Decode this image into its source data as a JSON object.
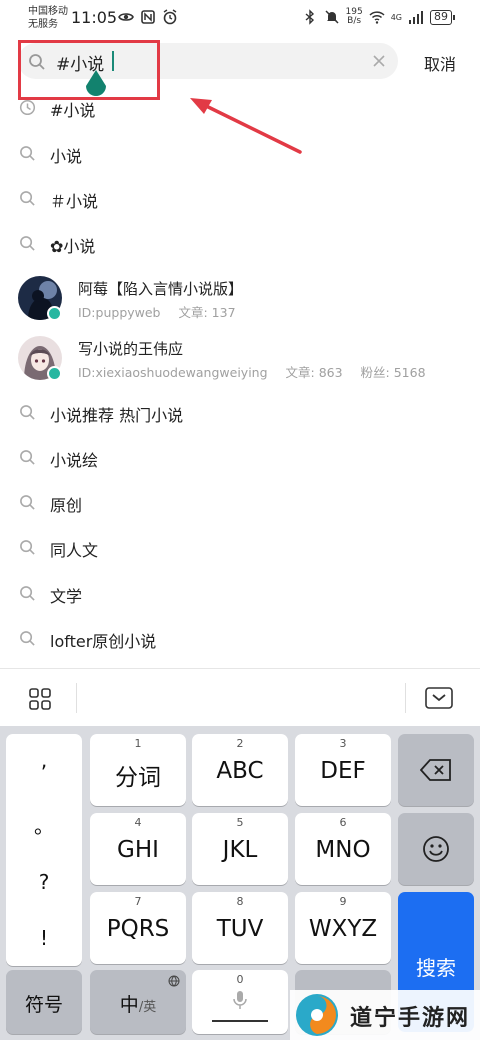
{
  "status_bar": {
    "carrier_line1": "中国移动",
    "carrier_line2": "无服务",
    "time": "11:05",
    "speed_top": "195",
    "speed_bottom": "B/s",
    "network": "4G",
    "battery": "89"
  },
  "search": {
    "query": "#小说",
    "cancel_label": "取消"
  },
  "suggestions_top": [
    {
      "label": "#小说",
      "icon": "history-clock-icon"
    },
    {
      "label": "小说",
      "icon": "search-icon"
    },
    {
      "label": "＃小说",
      "icon": "search-icon"
    },
    {
      "label": "✿小说",
      "icon": "search-icon"
    }
  ],
  "users": [
    {
      "name": "阿莓【陷入言情小说版】",
      "id": "ID:puppyweb",
      "articles": "文章: 137",
      "fans": ""
    },
    {
      "name": "写小说的王伟应",
      "id": "ID:xiexiaoshuodewangweiying",
      "articles": "文章: 863",
      "fans": "粉丝: 5168"
    }
  ],
  "suggestions_bottom": [
    {
      "label": "小说推荐 热门小说"
    },
    {
      "label": "小说绘"
    },
    {
      "label": "原创"
    },
    {
      "label": "同人文"
    },
    {
      "label": "文学"
    },
    {
      "label": "lofter原创小说"
    }
  ],
  "keyboard": {
    "punct": [
      ",",
      "。",
      "?",
      "!"
    ],
    "keys": [
      {
        "num": "1",
        "main": "分词"
      },
      {
        "num": "2",
        "main": "ABC"
      },
      {
        "num": "3",
        "main": "DEF"
      },
      {
        "num": "4",
        "main": "GHI"
      },
      {
        "num": "5",
        "main": "JKL"
      },
      {
        "num": "6",
        "main": "MNO"
      },
      {
        "num": "7",
        "main": "PQRS"
      },
      {
        "num": "8",
        "main": "TUV"
      },
      {
        "num": "9",
        "main": "WXYZ"
      }
    ],
    "symbol_label": "符号",
    "lang_main": "中",
    "lang_alt": "/英",
    "zero": "0",
    "search_label": "搜索"
  },
  "watermark": "道宁手游网",
  "colors": {
    "accent": "#1c6ef2",
    "highlight": "#e23a45",
    "verified": "#27b7a1"
  }
}
